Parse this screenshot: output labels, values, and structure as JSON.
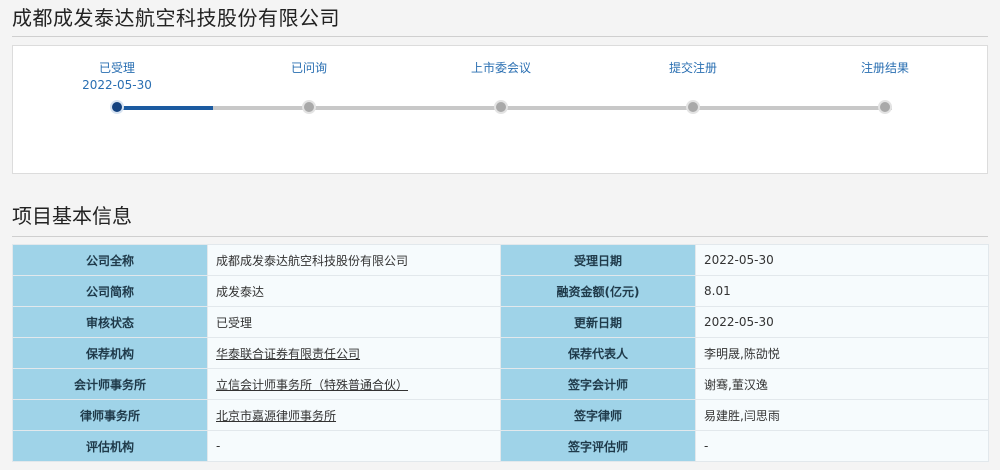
{
  "header": {
    "title": "成都成发泰达航空科技股份有限公司"
  },
  "progress": {
    "steps": [
      {
        "label": "已受理",
        "date": "2022-05-30",
        "state": "active"
      },
      {
        "label": "已问询",
        "date": "",
        "state": "pending"
      },
      {
        "label": "上市委会议",
        "date": "",
        "state": "pending"
      },
      {
        "label": "提交注册",
        "date": "",
        "state": "pending"
      },
      {
        "label": "注册结果",
        "date": "",
        "state": "pending"
      }
    ],
    "completed_fraction": 0.125,
    "colors": {
      "active": "#14427f",
      "pending": "#a9a9a9",
      "label": "#2a6fb2"
    }
  },
  "section": {
    "title": "项目基本信息"
  },
  "info": {
    "rows": [
      {
        "k1": "公司全称",
        "v1": "成都成发泰达航空科技股份有限公司",
        "k2": "受理日期",
        "v2": "2022-05-30"
      },
      {
        "k1": "公司简称",
        "v1": "成发泰达",
        "k2": "融资金额(亿元)",
        "v2": "8.01"
      },
      {
        "k1": "审核状态",
        "v1": "已受理",
        "k2": "更新日期",
        "v2": "2022-05-30"
      },
      {
        "k1": "保荐机构",
        "v1": "华泰联合证券有限责任公司",
        "k2": "保荐代表人",
        "v2": "李明晟,陈劭悦"
      },
      {
        "k1": "会计师事务所",
        "v1": "立信会计师事务所（特殊普通合伙）",
        "k2": "签字会计师",
        "v2": "谢骞,董汉逸"
      },
      {
        "k1": "律师事务所",
        "v1": "北京市嘉源律师事务所",
        "k2": "签字律师",
        "v2": "易建胜,闫思雨"
      },
      {
        "k1": "评估机构",
        "v1": "-",
        "k2": "签字评估师",
        "v2": "-"
      }
    ],
    "colors": {
      "key_bg": "#9fd3e8",
      "value_bg": "#f6fbfd"
    }
  }
}
